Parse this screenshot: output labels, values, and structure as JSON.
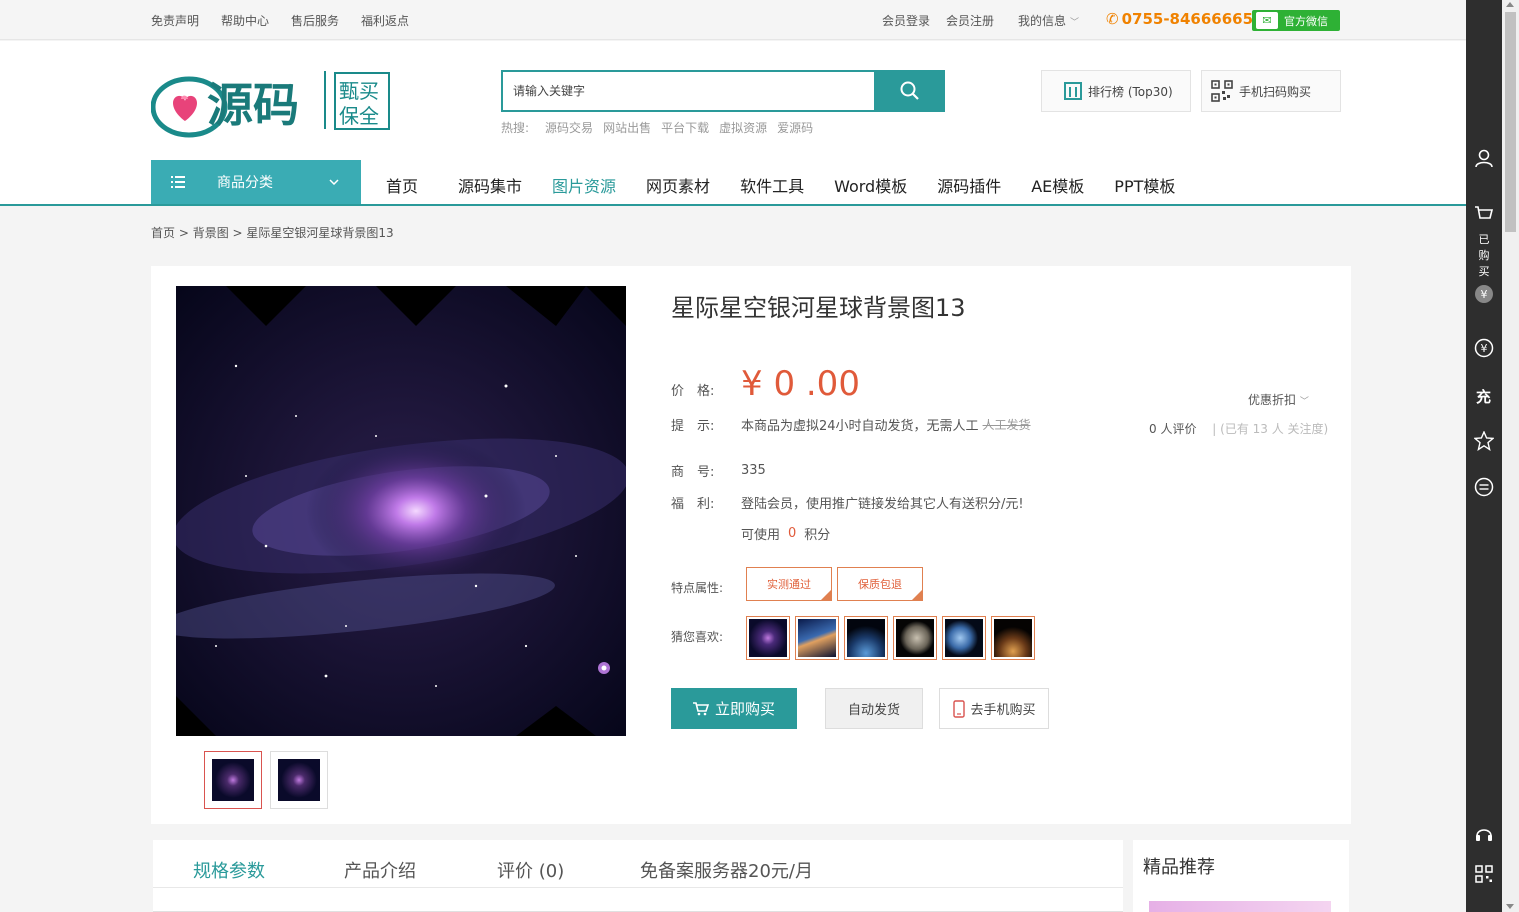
{
  "topbar": {
    "links": [
      "免责声明",
      "帮助中心",
      "售后服务",
      "福利返点"
    ],
    "login": "会员登录",
    "register": "会员注册",
    "my_info": "我的信息",
    "phone": "0755-84666665",
    "wechat": "官方微信"
  },
  "header": {
    "logo_alt": "爱源码 甄买保全",
    "search_placeholder": "请输入关键字",
    "hot_label": "热搜:",
    "hot_words": [
      "源码交易",
      "网站出售",
      "平台下载",
      "虚拟资源",
      "爱源码"
    ],
    "rank_button": "排行榜 (Top30)",
    "scan_button": "手机扫码购买"
  },
  "nav": {
    "category_label": "商品分类",
    "items": [
      "首页",
      "源码集市",
      "图片资源",
      "网页素材",
      "软件工具",
      "Word模板",
      "源码插件",
      "AE模板",
      "PPT模板"
    ],
    "active_index": 2
  },
  "breadcrumb": [
    "首页",
    "背景图",
    "星际星空银河星球背景图13"
  ],
  "product": {
    "title": "星际星空银河星球背景图13",
    "price_label": "价　格:",
    "price": "¥ 0 .00",
    "tip_label": "提　示:",
    "tip": "本商品为虚拟24小时自动发货，无需人工",
    "tip_strike": "人工发货",
    "sku_label": "商　号:",
    "sku": "335",
    "benefit_label": "福　利:",
    "benefit": "登陆会员，使用推广链接发给其它人有送积分/元!",
    "points_prefix": "可使用",
    "points_value": "0",
    "points_suffix": "积分",
    "discount": "优惠折扣",
    "reviews": "0 人评价",
    "attention": "| (已有 13 人 关注度)",
    "features_label": "特点属性:",
    "features": [
      "实测通过",
      "保质包退"
    ],
    "likes_label": "猜您喜欢:",
    "buy_button": "立即购买",
    "auto_button": "自动发货",
    "mobile_button": "去手机购买"
  },
  "tabs": {
    "items": [
      "规格参数",
      "产品介绍",
      "评价 (0)",
      "免备案服务器20元/月"
    ],
    "recommend_title": "精品推荐"
  },
  "sidebar": {
    "purchased": "已购买",
    "recharge": "充"
  },
  "colors": {
    "accent": "#2a9a9a",
    "price": "#e05a3a",
    "phone": "#f08200",
    "wechat": "#2eb135"
  }
}
